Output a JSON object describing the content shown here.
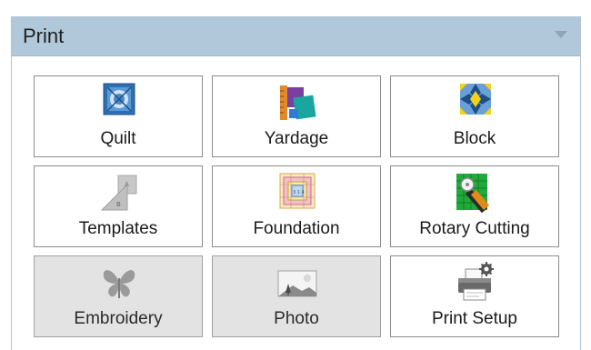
{
  "panel": {
    "title": "Print",
    "tiles": [
      {
        "label": "Quilt",
        "icon": "quilt-icon",
        "enabled": true
      },
      {
        "label": "Yardage",
        "icon": "yardage-icon",
        "enabled": true
      },
      {
        "label": "Block",
        "icon": "block-icon",
        "enabled": true
      },
      {
        "label": "Templates",
        "icon": "templates-icon",
        "enabled": true
      },
      {
        "label": "Foundation",
        "icon": "foundation-icon",
        "enabled": true
      },
      {
        "label": "Rotary Cutting",
        "icon": "rotary-cutting-icon",
        "enabled": true
      },
      {
        "label": "Embroidery",
        "icon": "embroidery-icon",
        "enabled": false
      },
      {
        "label": "Photo",
        "icon": "photo-icon",
        "enabled": false
      },
      {
        "label": "Print Setup",
        "icon": "printer-icon",
        "enabled": true
      }
    ]
  },
  "colors": {
    "header_bg": "#b0c8da",
    "disabled_bg": "#e3e3e3"
  }
}
